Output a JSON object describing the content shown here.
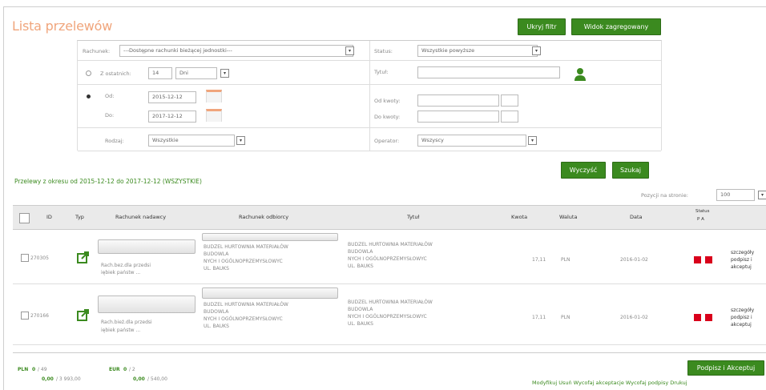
{
  "title": "Lista przelewów",
  "buttons": {
    "hide_filter": "Ukryj filtr",
    "grouped_view": "Widok zagregowany",
    "clear": "Wyczyść",
    "search": "Szukaj",
    "sign_accept": "Podpisz i Akceptuj"
  },
  "filters": {
    "account_label": "Rachunek:",
    "account_value": "---Dostępne rachunki bieżącej jednostki---",
    "status_label": "Status:",
    "status_value": "Wszystkie powyższe",
    "period_label": "Z ostatnich:",
    "period_value": "14",
    "period_unit": "Dni",
    "title_label": "Tytuł:",
    "title_value": "",
    "from_label": "Od:",
    "from_value": "2015-12-12",
    "to_label": "Do:",
    "to_value": "2017-12-12",
    "amount_from_label": "Od kwoty:",
    "amount_to_label": "Do kwoty:",
    "type_label": "Rodzaj:",
    "type_value": "Wszystkie",
    "operator_label": "Operator:",
    "operator_value": "Wszyscy"
  },
  "summary": "Przelewy z okresu od 2015-12-12 do 2017-12-12 (WSZYSTKIE)",
  "per_page_label": "Pozycji na stronie:",
  "per_page_value": "100",
  "columns": [
    "ID",
    "Typ",
    "Rachunek nadawcy",
    "Rachunek odbiorcy",
    "Tytuł",
    "Kwota",
    "Waluta",
    "Data",
    "Status",
    "P A"
  ],
  "rows": [
    {
      "id": "270305",
      "sender_note": "Rach.bez.dla przedsi",
      "sender_note2": "iębiek państw ...",
      "recipient1": "BUDZEL HURTOWNIA MATERIAŁÓW",
      "recipient2": "BUDOWLA",
      "recipient3": "NYCH I OGÓLNOPRZEMYSŁOWYC",
      "recipient4": "UL. BAUKS",
      "title1": "BUDZEL HURTOWNIA MATERIAŁÓW",
      "title2": "BUDOWLA",
      "title3": "NYCH I OGÓLNOPRZEMYSŁOWYC",
      "title4": "UL. BAUKS",
      "amount": "17,11",
      "currency": "PLN",
      "date": "2016-01-02",
      "act1": "szczegóły",
      "act2": "podpisz i",
      "act3": "akceptuj"
    },
    {
      "id": "270166",
      "sender_note": "Rach.bież.dla przedsi",
      "sender_note2": "iębiek państw ...",
      "recipient1": "BUDZEL HURTOWNIA MATERIAŁÓW",
      "recipient2": "BUDOWLA",
      "recipient3": "NYCH I OGÓLNOPRZEMYSŁOWYC",
      "recipient4": "UL. BAUKS",
      "title1": "BUDZEL HURTOWNIA MATERIAŁÓW",
      "title2": "BUDOWLA",
      "title3": "NYCH I OGÓLNOPRZEMYSŁOWYC",
      "title4": "UL. BAUKS",
      "amount": "17,11",
      "currency": "PLN",
      "date": "2016-01-02",
      "act1": "szczegóły",
      "act2": "podpisz i",
      "act3": "akceptuj"
    }
  ],
  "footer": {
    "pln_label": "PLN",
    "pln_count": "0",
    "pln_total": "/ 49",
    "pln_amount": "0,00",
    "pln_amount_total": "/ 3 993,00",
    "eur_label": "EUR",
    "eur_count": "0",
    "eur_total": "/ 2",
    "eur_amount": "0,00",
    "eur_amount_total": "/ 540,00",
    "links": "Modyfikuj  Usuń  Wycofaj akceptacje  Wycofaj podpisy  Drukuj"
  },
  "colors": {
    "accent": "#3b8a1f",
    "title": "#f0a57c",
    "status": "#d9001b"
  }
}
